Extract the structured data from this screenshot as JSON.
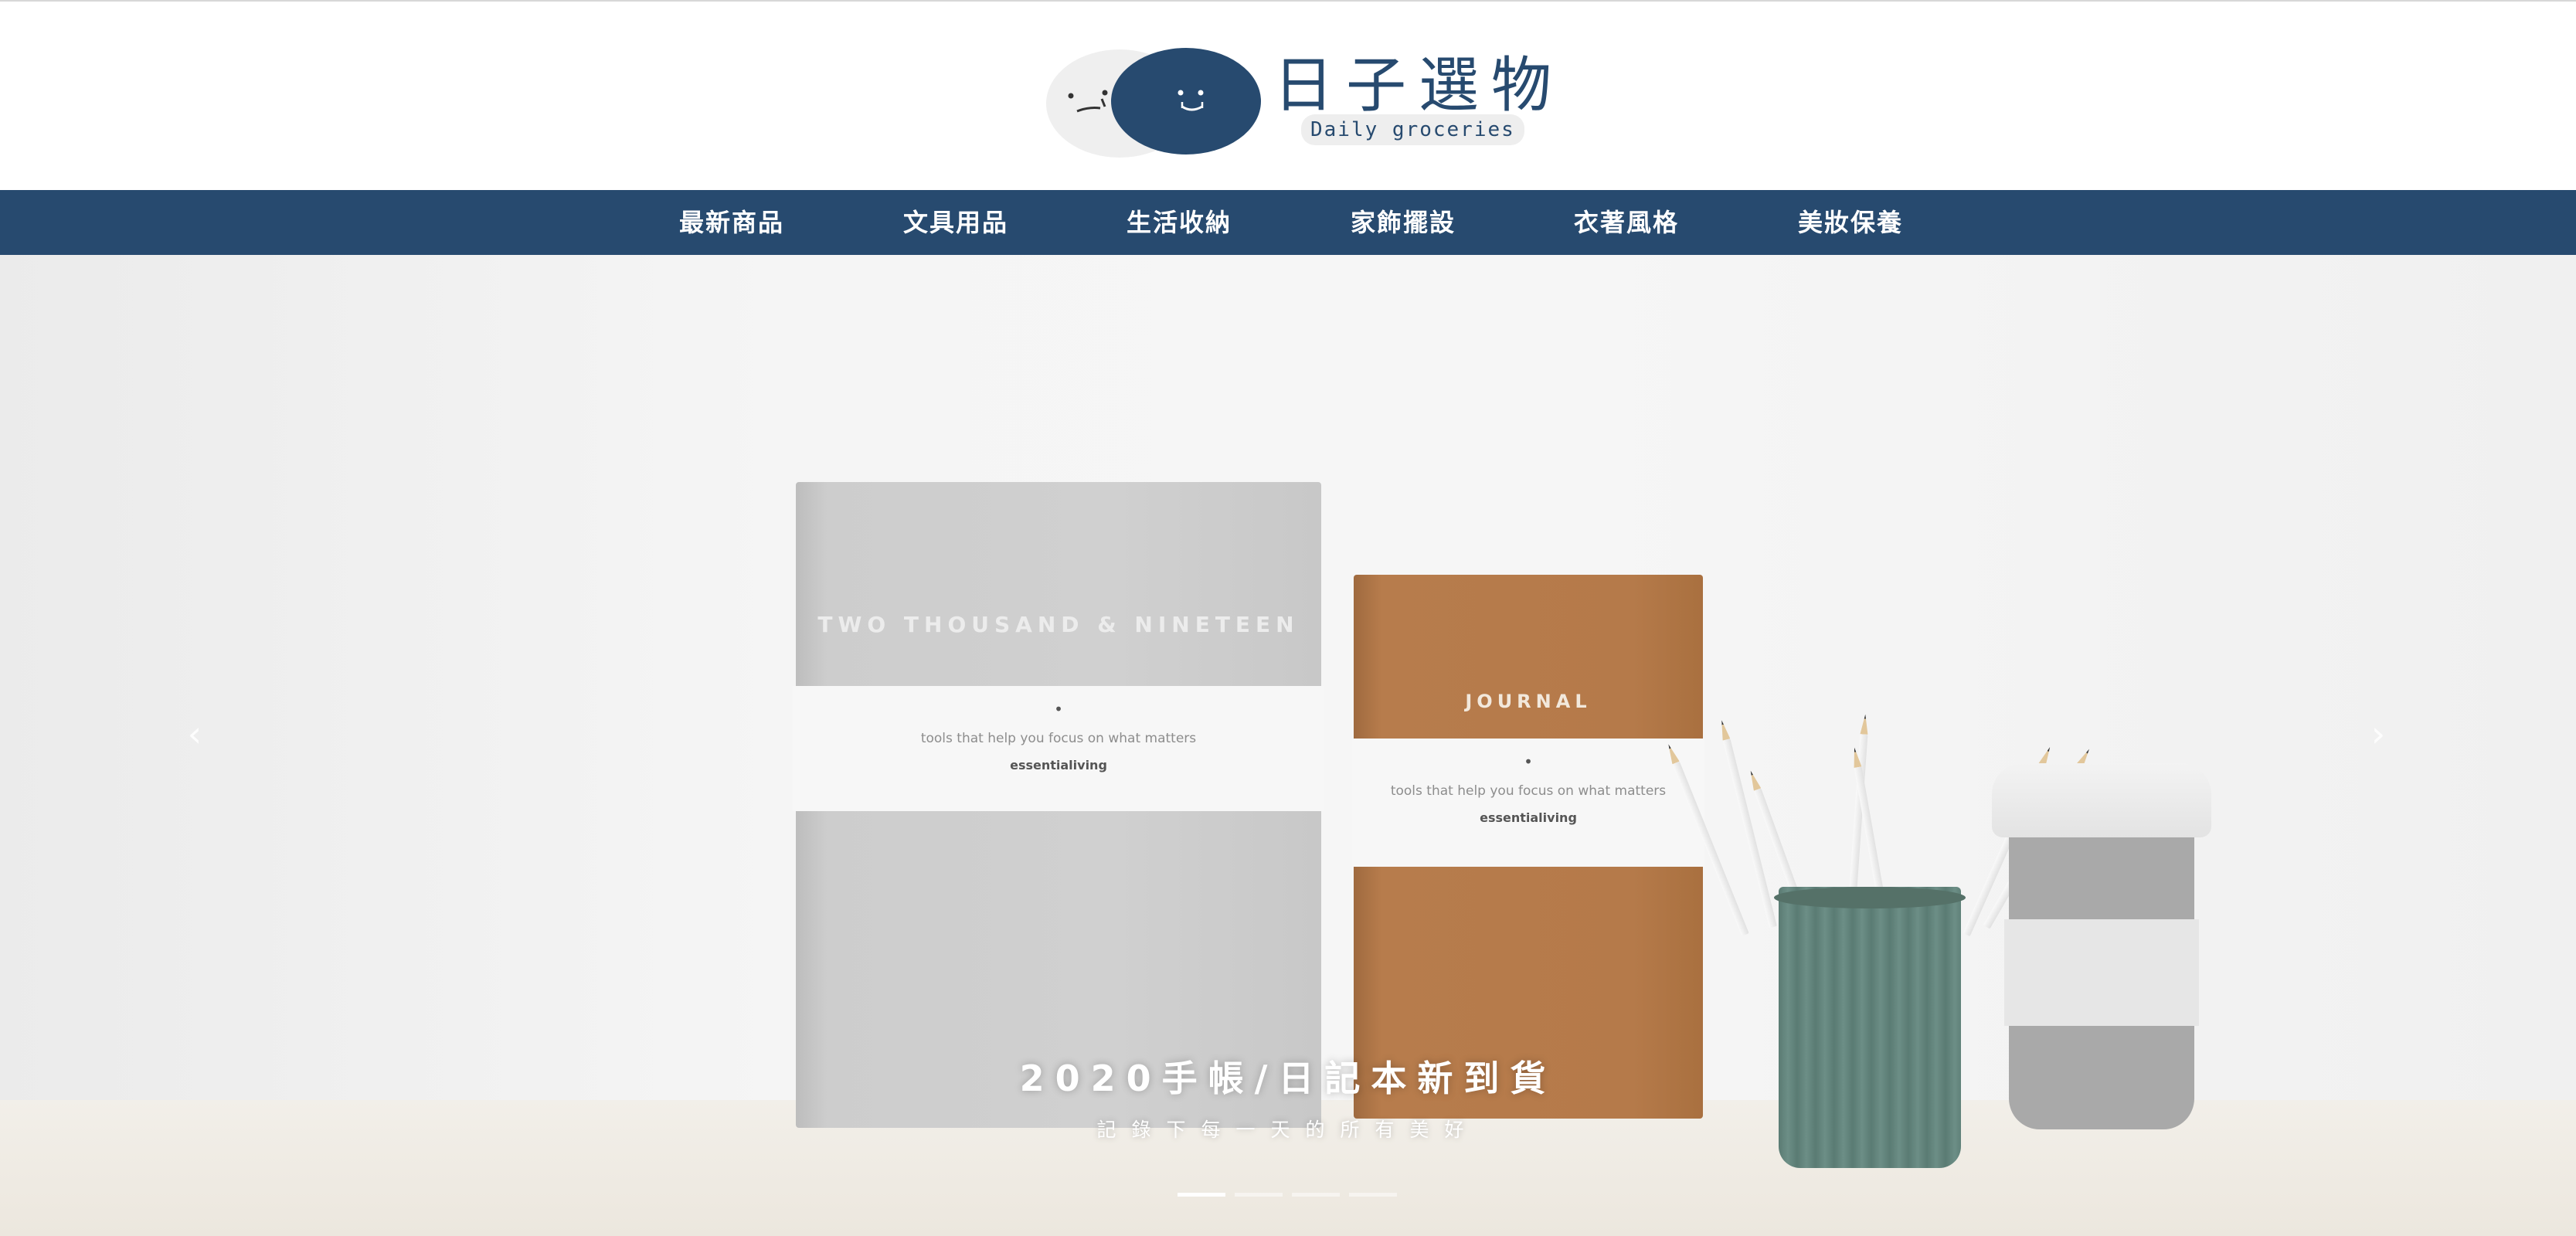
{
  "brand": {
    "title": "日子選物",
    "subtitle": "Daily groceries",
    "primary_color": "#274a6f"
  },
  "nav": {
    "items": [
      {
        "label": "最新商品"
      },
      {
        "label": "文具用品"
      },
      {
        "label": "生活收納"
      },
      {
        "label": "家飾擺設"
      },
      {
        "label": "衣著風格"
      },
      {
        "label": "美妝保養"
      }
    ]
  },
  "hero": {
    "title": "2020手帳/日記本新到貨",
    "subtitle": "記錄下每一天的所有美好",
    "slide_count": 4,
    "active_slide": 1,
    "prev_icon": "chevron-left-icon",
    "next_icon": "chevron-right-icon",
    "image": {
      "book_grey_title": "TWO THOUSAND & NINETEEN",
      "book_brown_title": "JOURNAL",
      "band_tagline": "tools that help you focus on what matters",
      "band_brand": "essentialiving"
    }
  }
}
